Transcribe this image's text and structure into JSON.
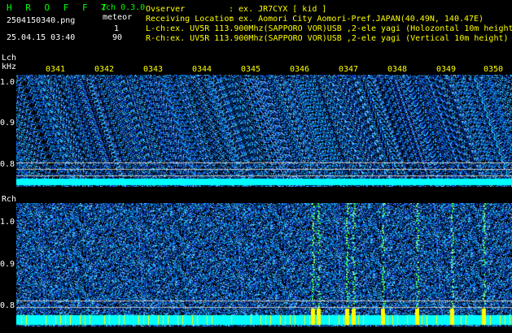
{
  "header": {
    "app_title": "H R O F F T",
    "channel_mode": "2ch 0.3.0",
    "type_label": "meteor",
    "file_name": "2504150340.png",
    "datetime": "25.04.15 03:40",
    "count_l": "1",
    "count_r": "90",
    "observer_label": "Ovserver",
    "observer_value": ": ex. JR7CYX [ kid ]",
    "location_label": "Receiving Location",
    "location_value": ": ex. Aomori City Aomori-Pref.JAPAN(40.49N, 140.47E)",
    "lch_info": "L-ch:ex. UV5R 113.900Mhz(SAPPORO VOR)USB ,2-ele yagi (Holozontal 10m height",
    "rch_info": "R-ch:ex. UV5R 113.900Mhz(SAPPORO VOR)USB ,2-ele yagi (Vertical 10m height)"
  },
  "lch": {
    "label": "Lch",
    "unit": "kHz",
    "y_ticks": [
      "1.0",
      "0.9",
      "0.8"
    ]
  },
  "rch": {
    "label": "Rch",
    "y_ticks": [
      "1.0",
      "0.9",
      "0.8"
    ]
  },
  "time_ticks": [
    "0341",
    "0342",
    "0343",
    "0344",
    "0345",
    "0346",
    "0347",
    "0348",
    "0349",
    "0350"
  ],
  "colors": {
    "background": "#000000",
    "noise_blue": "#1040c0",
    "noise_cyan": "#00e0ff",
    "carrier": "#00ffff",
    "meteor": "#ffff00",
    "tick_text": "#ffff00",
    "header_green": "#00ff00"
  }
}
